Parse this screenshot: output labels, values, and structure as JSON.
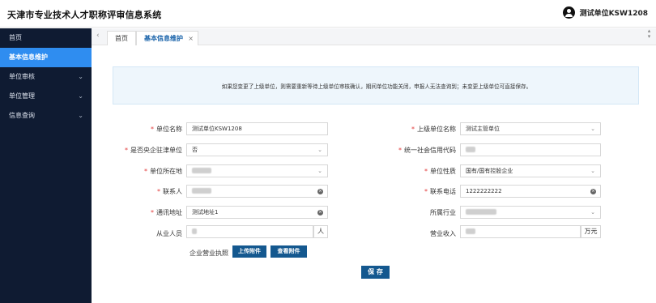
{
  "app": {
    "title": "天津市专业技术人才职称评审信息系统",
    "user": "测试单位KSW1208"
  },
  "sidebar": {
    "items": [
      {
        "label": "首页",
        "has_arrow": false,
        "active": false
      },
      {
        "label": "基本信息维护",
        "has_arrow": false,
        "active": true
      },
      {
        "label": "单位审核",
        "has_arrow": true,
        "active": false
      },
      {
        "label": "单位管理",
        "has_arrow": true,
        "active": false
      },
      {
        "label": "信息查询",
        "has_arrow": true,
        "active": false
      }
    ]
  },
  "tabs": {
    "home": "首页",
    "current": "基本信息维护",
    "close_icon": "×"
  },
  "notice": "如果您变更了上级单位，则需要重新等待上级单位审核确认，期间单位功能关闭，申报人无法查询到；未变更上级单位可直接保存。",
  "form": {
    "unit_name": {
      "label": "单位名称",
      "value": "测试单位KSW1208",
      "required": true
    },
    "parent_unit": {
      "label": "上级单位名称",
      "value": "测试主管单位",
      "required": true
    },
    "central_enterprise": {
      "label": "是否央企驻津单位",
      "value": "否",
      "required": true
    },
    "credit_code": {
      "label": "统一社会信用代码",
      "value": "",
      "required": true
    },
    "location": {
      "label": "单位所在地",
      "value": "",
      "required": true
    },
    "nature": {
      "label": "单位性质",
      "value": "国有/国有控股企业",
      "required": true
    },
    "contact": {
      "label": "联系人",
      "value": "",
      "required": true
    },
    "phone": {
      "label": "联系电话",
      "value": "1222222222",
      "required": true
    },
    "address": {
      "label": "通讯地址",
      "value": "测试地址1",
      "required": true
    },
    "industry": {
      "label": "所属行业",
      "value": "",
      "required": false
    },
    "employees": {
      "label": "从业人员",
      "value": "",
      "unit": "人",
      "required": false
    },
    "revenue": {
      "label": "营业收入",
      "value": "",
      "unit": "万元",
      "required": false
    },
    "license": {
      "label": "企业营业执照",
      "upload_label": "上传附件",
      "view_label": "查看附件"
    }
  },
  "actions": {
    "save_label": "保 存"
  },
  "icons": {
    "dropdown": "chevron-down-icon",
    "clear": "clear-circle-icon",
    "user": "user-avatar-icon",
    "close": "close-icon"
  },
  "colors": {
    "sidebar_bg": "#0f1b32",
    "active_item": "#2f8df0",
    "button": "#14588f",
    "required": "#e23b3b",
    "notice_bg": "#eef6fc"
  }
}
